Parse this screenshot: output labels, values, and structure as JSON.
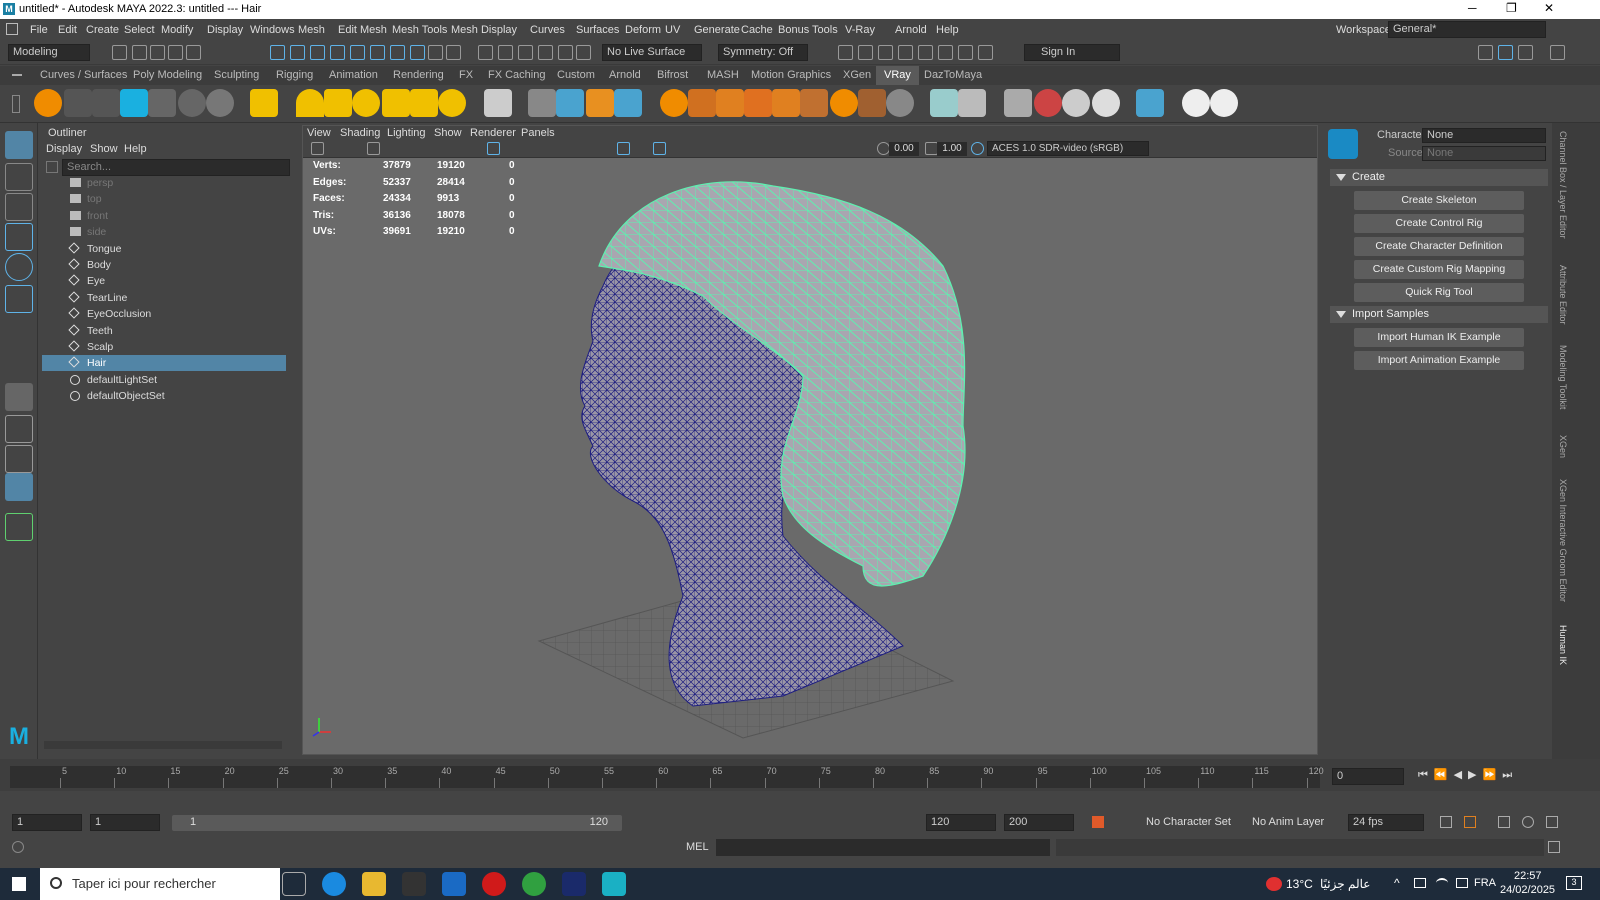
{
  "window": {
    "title": "untitled* - Autodesk MAYA 2022.3: untitled  ---  Hair",
    "logo": "M"
  },
  "menubar": {
    "items": [
      "File",
      "Edit",
      "Create",
      "Select",
      "Modify",
      "Display",
      "Windows",
      "Mesh",
      "Edit Mesh",
      "Mesh Tools",
      "Mesh Display",
      "Curves",
      "Surfaces",
      "Deform",
      "UV",
      "Generate",
      "Cache",
      "Bonus Tools",
      "V-Ray",
      "Arnold",
      "Help"
    ],
    "workspace_label": "Workspace:",
    "workspace_value": "General*"
  },
  "statusline": {
    "mode": "Modeling",
    "live_surface": "No Live Surface",
    "symmetry": "Symmetry: Off",
    "sign_in": "Sign In"
  },
  "shelf_tabs": [
    "Curves / Surfaces",
    "Poly Modeling",
    "Sculpting",
    "Rigging",
    "Animation",
    "Rendering",
    "FX",
    "FX Caching",
    "Custom",
    "Arnold",
    "Bifrost",
    "MASH",
    "Motion Graphics",
    "XGen",
    "VRay",
    "DazToMaya"
  ],
  "shelf_active": "VRay",
  "outliner": {
    "title": "Outliner",
    "menu": [
      "Display",
      "Show",
      "Help"
    ],
    "search_placeholder": "Search...",
    "items": [
      {
        "label": "persp",
        "type": "camera",
        "dim": true
      },
      {
        "label": "top",
        "type": "camera",
        "dim": true
      },
      {
        "label": "front",
        "type": "camera",
        "dim": true
      },
      {
        "label": "side",
        "type": "camera",
        "dim": true
      },
      {
        "label": "Tongue",
        "type": "mesh"
      },
      {
        "label": "Body",
        "type": "mesh"
      },
      {
        "label": "Eye",
        "type": "mesh"
      },
      {
        "label": "TearLine",
        "type": "mesh"
      },
      {
        "label": "EyeOcclusion",
        "type": "mesh"
      },
      {
        "label": "Teeth",
        "type": "mesh"
      },
      {
        "label": "Scalp",
        "type": "mesh"
      },
      {
        "label": "Hair",
        "type": "mesh",
        "selected": true
      },
      {
        "label": "defaultLightSet",
        "type": "set"
      },
      {
        "label": "defaultObjectSet",
        "type": "set"
      }
    ]
  },
  "viewport": {
    "menu": [
      "View",
      "Shading",
      "Lighting",
      "Show",
      "Renderer",
      "Panels"
    ],
    "exposure": "0.00",
    "gamma": "1.00",
    "color_space": "ACES 1.0 SDR-video (sRGB)",
    "stats": [
      {
        "label": "Verts:",
        "a": "37879",
        "b": "19120",
        "c": "0"
      },
      {
        "label": "Edges:",
        "a": "52337",
        "b": "28414",
        "c": "0"
      },
      {
        "label": "Faces:",
        "a": "24334",
        "b": "9913",
        "c": "0"
      },
      {
        "label": "Tris:",
        "a": "36136",
        "b": "18078",
        "c": "0"
      },
      {
        "label": "UVs:",
        "a": "39691",
        "b": "19210",
        "c": "0"
      }
    ]
  },
  "humanik": {
    "character_label": "Character:",
    "character_value": "None",
    "source_label": "Source:",
    "source_value": "None",
    "create_section": "Create",
    "create_buttons": [
      "Create Skeleton",
      "Create Control Rig",
      "Create Character Definition",
      "Create Custom Rig Mapping",
      "Quick Rig Tool"
    ],
    "import_section": "Import Samples",
    "import_buttons": [
      "Import Human IK Example",
      "Import Animation Example"
    ]
  },
  "side_tabs": [
    "Channel Box / Layer Editor",
    "Attribute Editor",
    "Modeling Toolkit",
    "XGen",
    "XGen Interactive Groom Editor",
    "Human IK"
  ],
  "timeline": {
    "ticks": [
      "5",
      "10",
      "15",
      "20",
      "25",
      "30",
      "35",
      "40",
      "45",
      "50",
      "55",
      "60",
      "65",
      "70",
      "75",
      "80",
      "85",
      "90",
      "95",
      "100",
      "105",
      "110",
      "115",
      "120"
    ],
    "current_frame": "0"
  },
  "range": {
    "start": "1",
    "start2": "1",
    "slider_start": "1",
    "slider_end": "120",
    "end": "120",
    "end2": "200",
    "character_set": "No Character Set",
    "anim_layer": "No Anim Layer",
    "fps": "24 fps"
  },
  "cmdline": {
    "label": "MEL"
  },
  "taskbar": {
    "search": "Taper ici pour rechercher",
    "weather": "13°C",
    "weather_text": "عالم جزئيًا",
    "lang": "FRA",
    "time": "22:57",
    "date": "24/02/2025",
    "notif": "3"
  }
}
